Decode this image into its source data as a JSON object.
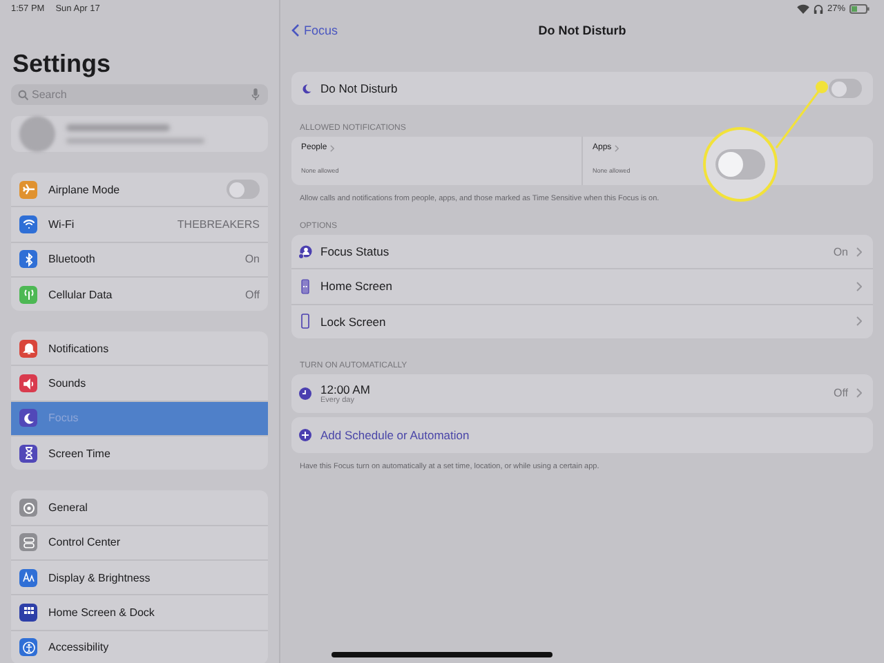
{
  "status_bar": {
    "time": "1:57 PM",
    "date": "Sun Apr 17",
    "battery": "27%"
  },
  "sidebar": {
    "title": "Settings",
    "search": {
      "placeholder": "Search"
    },
    "groups": [
      {
        "items": [
          {
            "label": "Airplane Mode",
            "kind": "toggle",
            "on": false,
            "color": "#e0922f",
            "selected": false
          },
          {
            "label": "Wi-Fi",
            "kind": "value",
            "value": "THEBREAKERS",
            "color": "#2f6fd6",
            "selected": false
          },
          {
            "label": "Bluetooth",
            "kind": "value",
            "value": "On",
            "color": "#2f6fd6",
            "selected": false
          },
          {
            "label": "Cellular Data",
            "kind": "value",
            "value": "Off",
            "color": "#4db854",
            "selected": false
          }
        ]
      },
      {
        "items": [
          {
            "label": "Notifications",
            "kind": "plain",
            "color": "#d9463b",
            "selected": false
          },
          {
            "label": "Sounds",
            "kind": "plain",
            "color": "#d93b4e",
            "selected": false
          },
          {
            "label": "Focus",
            "kind": "plain",
            "color": "#5148b8",
            "selected": true
          },
          {
            "label": "Screen Time",
            "kind": "plain",
            "color": "#5148b8",
            "selected": false
          }
        ]
      },
      {
        "items": [
          {
            "label": "General",
            "kind": "plain",
            "color": "#8e8e93",
            "selected": false
          },
          {
            "label": "Control Center",
            "kind": "plain",
            "color": "#8e8e93",
            "selected": false
          },
          {
            "label": "Display & Brightness",
            "kind": "plain",
            "color": "#2f6fd6",
            "selected": false
          },
          {
            "label": "Home Screen & Dock",
            "kind": "plain",
            "color": "#2d3fa8",
            "selected": false
          },
          {
            "label": "Accessibility",
            "kind": "plain",
            "color": "#2f6fd6",
            "selected": false
          }
        ]
      }
    ]
  },
  "nav": {
    "back": "Focus",
    "title": "Do Not Disturb"
  },
  "dnd": {
    "label": "Do Not Disturb",
    "on": false
  },
  "allowed": {
    "header": "ALLOWED NOTIFICATIONS",
    "cells": [
      {
        "title": "People",
        "subtitle": "None allowed"
      },
      {
        "title": "Apps",
        "subtitle": "None allowed"
      }
    ],
    "footnote": "Allow calls and notifications from people, apps, and those marked as Time Sensitive when this Focus is on."
  },
  "options": {
    "header": "OPTIONS",
    "rows": [
      {
        "label": "Focus Status",
        "value": "On"
      },
      {
        "label": "Home Screen"
      },
      {
        "label": "Lock Screen"
      }
    ]
  },
  "automatic": {
    "header": "TURN ON AUTOMATICALLY",
    "schedule": {
      "time": "12:00 AM",
      "repeat": "Every day",
      "value": "Off"
    },
    "add": "Add Schedule or Automation",
    "footnote": "Have this Focus turn on automatically at a set time, location, or while using a certain app."
  }
}
